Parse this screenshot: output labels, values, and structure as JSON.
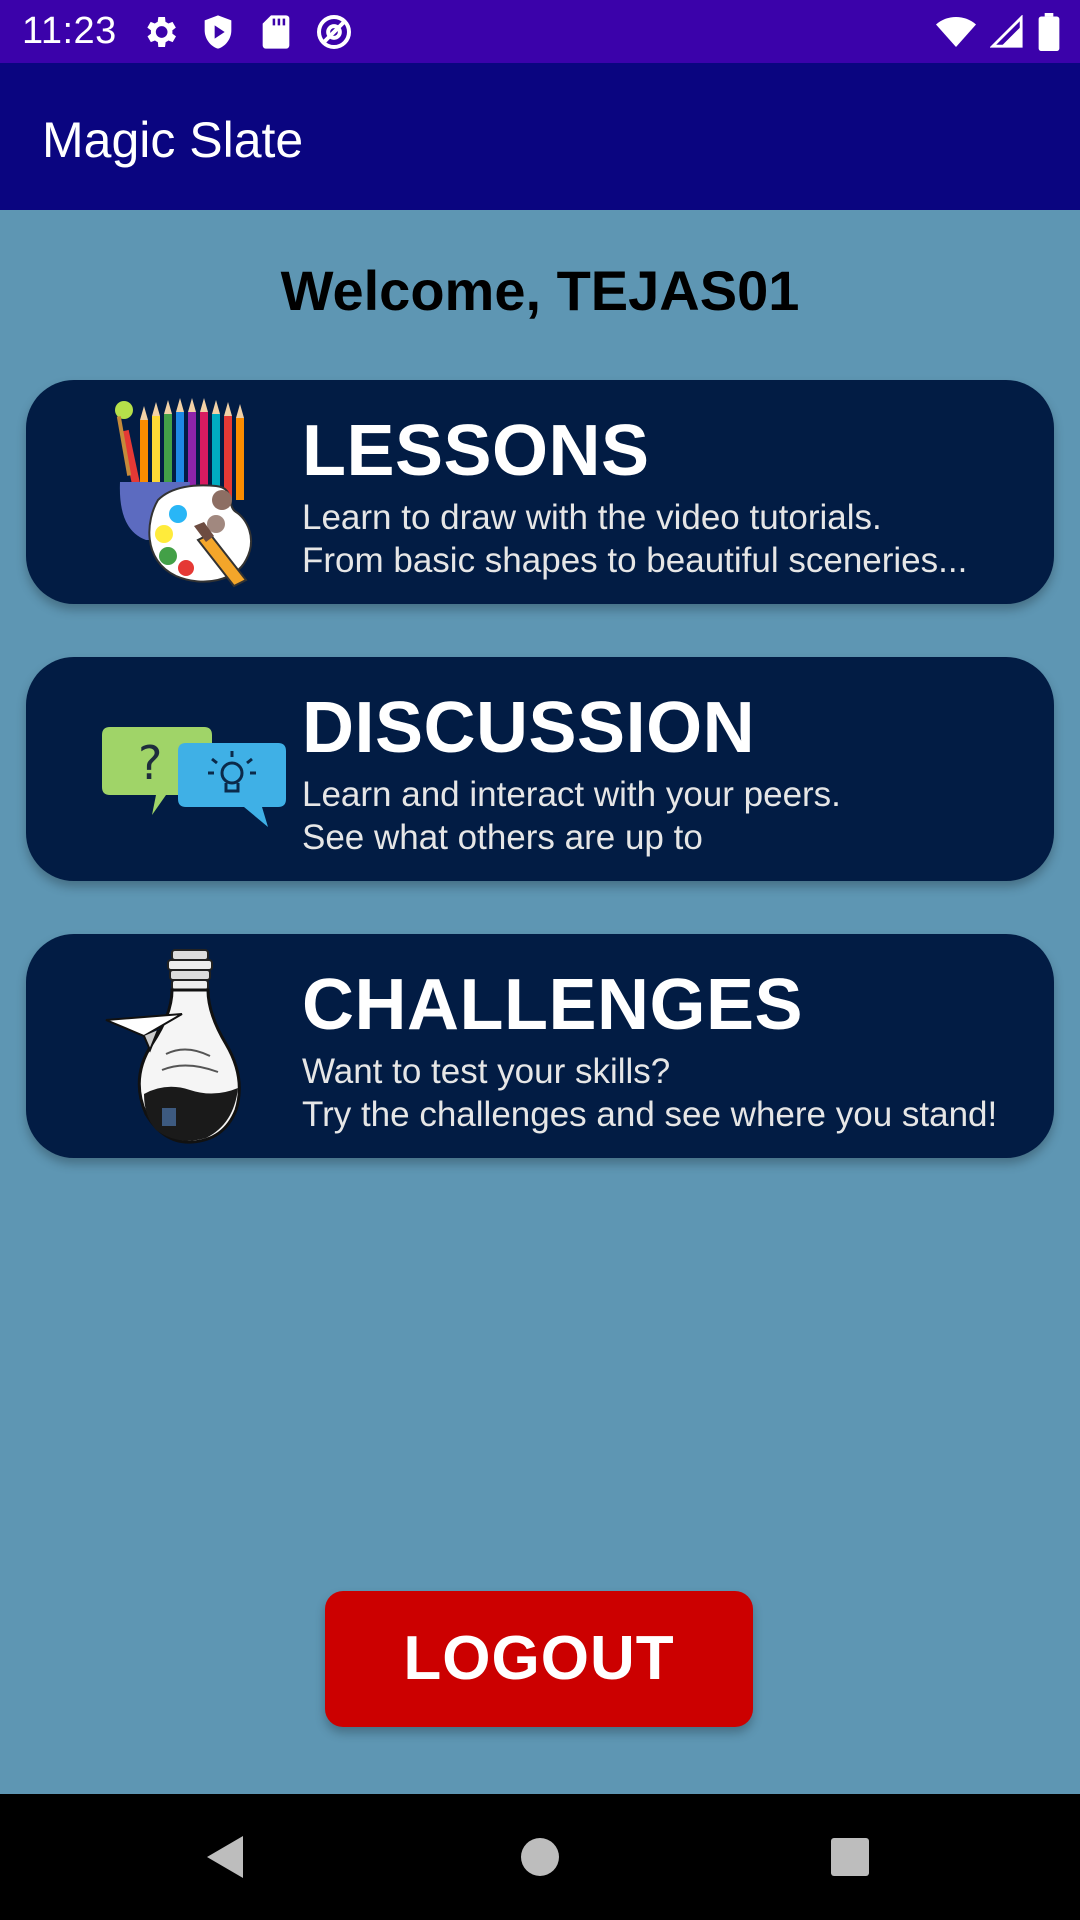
{
  "status_bar": {
    "time": "11:23",
    "left_icons": [
      "gear-icon",
      "shield-icon",
      "sd-card-icon",
      "at-sign-icon"
    ],
    "right_icons": [
      "wifi-icon",
      "signal-icon",
      "battery-icon"
    ]
  },
  "app_bar": {
    "title": "Magic Slate"
  },
  "welcome": "Welcome, TEJAS01",
  "cards": [
    {
      "title": "LESSONS",
      "line1": "Learn to draw with the video tutorials.",
      "line2": "From basic shapes to beautiful sceneries...",
      "icon": "art-supplies-icon"
    },
    {
      "title": "DISCUSSION",
      "line1": "Learn and interact with your peers.",
      "line2": "See what others are up to",
      "icon": "chat-bubbles-icon"
    },
    {
      "title": "CHALLENGES",
      "line1": "Want to test your skills?",
      "line2": "Try the challenges and see where you stand!",
      "icon": "lightbulb-icon"
    }
  ],
  "logout_label": "LOGOUT",
  "nav_bar": {
    "icons": [
      "back-icon",
      "home-icon",
      "recents-icon"
    ]
  },
  "colors": {
    "status_bar": "#3b02aa",
    "app_bar": "#0a0580",
    "background": "#5e96b3",
    "card": "#021c44",
    "logout": "#cc0000"
  }
}
